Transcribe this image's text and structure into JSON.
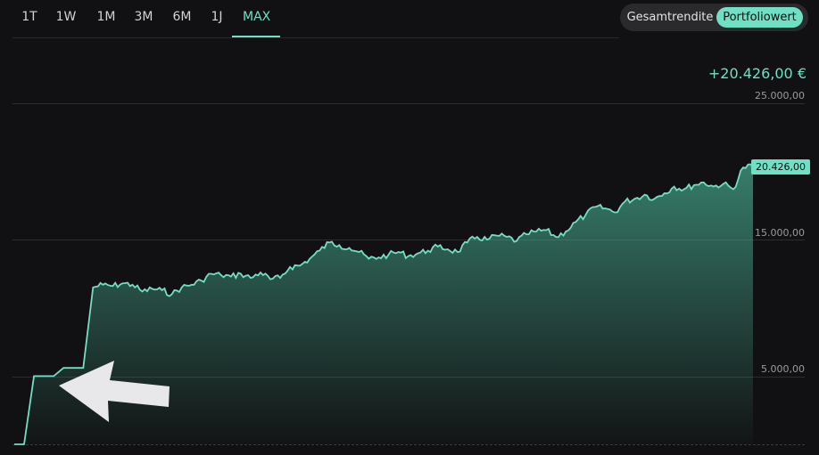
{
  "range_tabs": [
    {
      "label": "1T"
    },
    {
      "label": "1W"
    },
    {
      "label": "1M"
    },
    {
      "label": "3M"
    },
    {
      "label": "6M"
    },
    {
      "label": "1J"
    },
    {
      "label": "MAX"
    }
  ],
  "active_tab": "MAX",
  "view_toggle": {
    "options": [
      "Gesamtrendite",
      "Portfoliowert"
    ],
    "selected": "Portfoliowert"
  },
  "total_value": "+20.426,00 €",
  "current_value_label": "20.426,00",
  "colors": {
    "accent": "#6fe0c4",
    "background": "#111113"
  },
  "chart_data": {
    "type": "area",
    "y_tick_labels": [
      "25.000,00",
      "15.000,00",
      "5.000,00"
    ],
    "y_ticks": [
      25000,
      15000,
      5000
    ],
    "ylim": [
      0,
      25000
    ],
    "grid": true,
    "series": [
      {
        "values": [
          0,
          0,
          5000,
          5000,
          5000,
          5600,
          5600,
          5600,
          11500,
          11700,
          11600,
          11800,
          11700,
          11200,
          11400,
          11300,
          11000,
          11500,
          11700,
          12000,
          12500,
          12400,
          12300,
          12500,
          12200,
          12600,
          12100,
          12200,
          13000,
          13100,
          13600,
          14200,
          14800,
          14600,
          14400,
          14100,
          13600,
          13700,
          13900,
          14100,
          13800,
          14000,
          14200,
          14500,
          14300,
          14100,
          14800,
          15200,
          15000,
          15300,
          15200,
          14900,
          15400,
          15600,
          15700,
          15200,
          15600,
          16300,
          16800,
          17400,
          17300,
          17000,
          17800,
          18000,
          18300,
          18000,
          18400,
          18900,
          18700,
          19000,
          19200,
          18900,
          19100,
          18700,
          20300,
          20426
        ]
      }
    ]
  },
  "arrow": {
    "direction": "left"
  }
}
